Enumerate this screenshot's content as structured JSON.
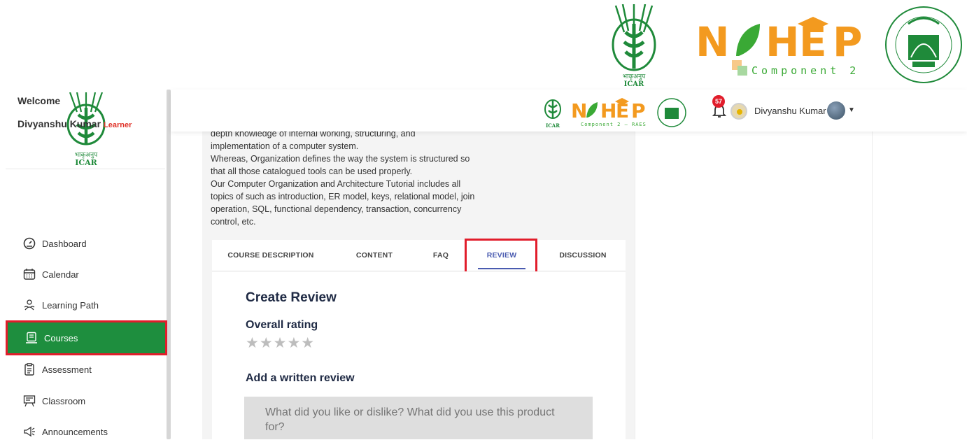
{
  "branding": {
    "icar_label_hindi": "भाकृअनुप",
    "icar_label": "ICAR",
    "nahep_text": "NAHEP",
    "component": "Component 2",
    "component_small": "Component 2 – RAES"
  },
  "header": {
    "notifications_count": "57",
    "user_name": "Divyanshu Kumar"
  },
  "sidebar": {
    "welcome": "Welcome",
    "user_name": "Divyanshu Kumar",
    "role": "Learner",
    "items": [
      {
        "label": "Dashboard",
        "icon": "dashboard-icon"
      },
      {
        "label": "Calendar",
        "icon": "calendar-icon"
      },
      {
        "label": "Learning Path",
        "icon": "learning-path-icon"
      },
      {
        "label": "Courses",
        "icon": "courses-icon",
        "active": true
      },
      {
        "label": "Assessment",
        "icon": "assessment-icon"
      },
      {
        "label": "Classroom",
        "icon": "classroom-icon"
      },
      {
        "label": "Announcements",
        "icon": "announcements-icon"
      }
    ]
  },
  "course": {
    "description_lines": [
      "depth knowledge of internal working, structuring, and",
      "implementation of a computer system.",
      "Whereas, Organization defines the way the system is structured so",
      "that all those catalogued tools can be used properly.",
      "Our Computer Organization and Architecture Tutorial includes all",
      "topics of such as introduction, ER model, keys, relational model, join",
      "operation, SQL, functional dependency, transaction, concurrency",
      "control, etc."
    ],
    "tabs": [
      {
        "label": "COURSE DESCRIPTION"
      },
      {
        "label": "CONTENT"
      },
      {
        "label": "FAQ"
      },
      {
        "label": "REVIEW",
        "active": true
      },
      {
        "label": "DISCUSSION"
      }
    ]
  },
  "review": {
    "title": "Create Review",
    "overall_rating_label": "Overall rating",
    "stars": "★★★★★",
    "rating_value": 0,
    "rating_max": 5,
    "written_label": "Add a written review",
    "placeholder": "What did you like or dislike? What did you use this product for?"
  },
  "colors": {
    "active_nav": "#1e8e3e",
    "highlight": "#e11d2b",
    "tab_active": "#4a5bb0",
    "nahep_orange": "#f39a1f",
    "nahep_green": "#3aa935"
  }
}
